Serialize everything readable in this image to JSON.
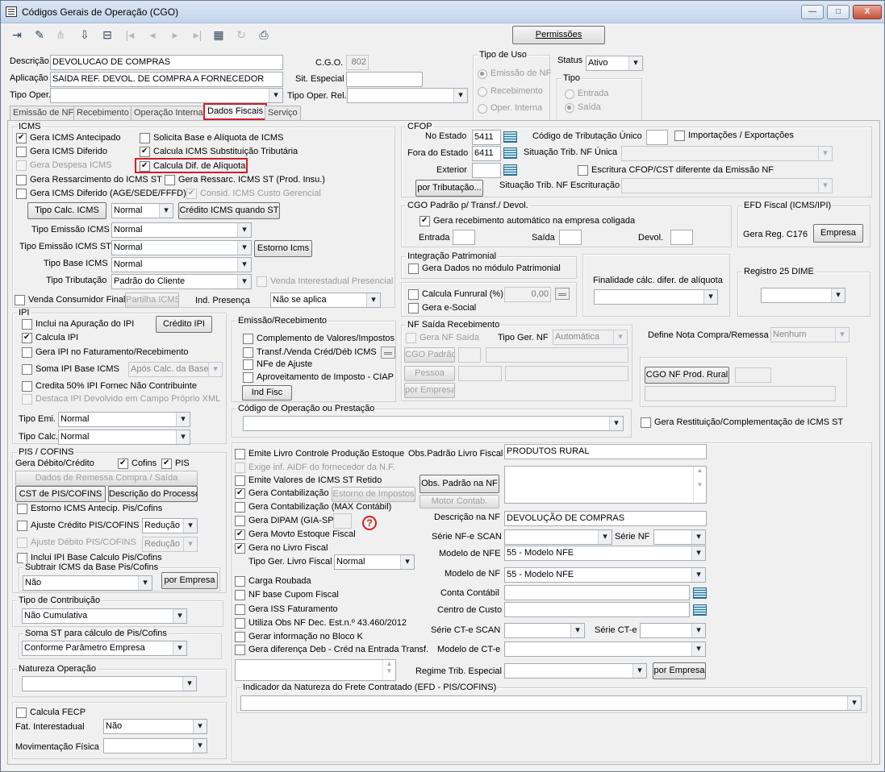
{
  "window": {
    "title": "Códigos Gerais de Operação (CGO)",
    "min": "—",
    "max": "□",
    "close": "X"
  },
  "toolbar": {
    "permissoes": "Permissões"
  },
  "header": {
    "descricao_label": "Descrição",
    "descricao_value": "DEVOLUCAO DE COMPRAS",
    "cgo_label": "C.G.O.",
    "cgo_value": "802",
    "aplicacao_label": "Aplicação",
    "aplicacao_value": "SAIDA REF. DEVOL. DE COMPRA A FORNECEDOR",
    "sit_especial_label": "Sit. Especial",
    "sit_especial_value": "",
    "tipo_oper_label": "Tipo Oper.",
    "tipo_oper_value": "",
    "tipo_oper_rel_label": "Tipo Oper. Rel.",
    "tipo_oper_rel_value": "",
    "tipo_uso_caption": "Tipo de Uso",
    "tipo_uso_options": [
      "Emissão de NF",
      "Recebimento",
      "Oper. Interna"
    ],
    "status_label": "Status",
    "status_value": "Ativo",
    "tipo_caption": "Tipo",
    "tipo_options": [
      "Entrada",
      "Saída"
    ]
  },
  "tabs": [
    "Emissão de NF",
    "Recebimento",
    "Operação Interna",
    "Dados Fiscais",
    "Serviço"
  ],
  "icms": {
    "caption": "ICMS",
    "gera_antecipado": "Gera ICMS Antecipado",
    "solicita_base": "Solicita Base e Alíquota de ICMS",
    "gera_diferido": "Gera ICMS Diferido",
    "calcula_st": "Calcula ICMS Substituição Tributária",
    "gera_despesa": "Gera Despesa ICMS",
    "calcula_dif": "Calcula Dif. de Alíquota",
    "gera_ressarcimento": "Gera Ressarcimento do ICMS ST",
    "gera_ressarc_prod": "Gera Ressarc. ICMS ST (Prod. Insu.)",
    "gera_diferido_age": "Gera ICMS Diferido (AGE/SEDE/FFFD)",
    "consid_custo": "Consid. ICMS Custo Gerencial",
    "tipo_calc_btn": "Tipo Calc. ICMS",
    "tipo_calc_value": "Normal",
    "credito_st_btn": "Crédito ICMS quando ST",
    "tipo_emissao_label": "Tipo Emissão ICMS",
    "tipo_emissao_value": "Normal",
    "tipo_emissao_st_label": "Tipo Emissão ICMS ST",
    "tipo_emissao_st_value": "Normal",
    "estorno_btn": "Estorno Icms",
    "tipo_base_label": "Tipo Base ICMS",
    "tipo_base_value": "Normal",
    "tipo_tributacao_label": "Tipo Tributação",
    "tipo_tributacao_value": "Padrão do Cliente",
    "venda_interestadual": "Venda Interestadual Presencial",
    "venda_consumidor": "Venda Consumidor Final",
    "partilha_btn": "Partilha ICMS",
    "ind_presenca_label": "Ind. Presença",
    "ind_presenca_value": "Não se aplica"
  },
  "cfop": {
    "caption": "CFOP",
    "no_estado_label": "No Estado",
    "no_estado_value": "5411",
    "fora_estado_label": "Fora do Estado",
    "fora_estado_value": "6411",
    "exterior_label": "Exterior",
    "exterior_value": "",
    "cod_trib_label": "Código de Tributação Único",
    "cod_trib_value": "",
    "importacoes": "Importações / Exportações",
    "sit_trib_label": "Situação Trib. NF Única",
    "sit_trib_value": "",
    "escritura_cfop": "Escritura CFOP/CST diferente da Emissão NF",
    "por_tributacao_btn": "por Tributação...",
    "sit_trib_escr_label": "Situação Trib. NF Escrituração",
    "sit_trib_escr_value": ""
  },
  "cgo_padrao": {
    "caption": "CGO Padrão p/ Transf./ Devol.",
    "gera_receb": "Gera recebimento automático na empresa coligada",
    "entrada_label": "Entrada",
    "saida_label": "Saída",
    "devol_label": "Devol.",
    "entrada_value": "",
    "saida_value": "",
    "devol_value": ""
  },
  "efd": {
    "caption": "EFD Fiscal (ICMS/IPI)",
    "gera_reg": "Gera Reg. C176",
    "empresa_btn": "Empresa"
  },
  "patrimonial": {
    "caption": "Integração Patrimonial",
    "gera_dados": "Gera Dados no módulo Patrimonial"
  },
  "finalidade": {
    "label": "Finalidade cálc. difer. de alíquota",
    "value": ""
  },
  "dime": {
    "caption": "Registro 25 DIME",
    "value": ""
  },
  "funrural": {
    "calcula": "Calcula Funrural (%)",
    "valor": "0,00",
    "gera_esocial": "Gera e-Social"
  },
  "ipi": {
    "caption": "IPI",
    "inclui_apuracao": "Inclui na Apuração do IPI",
    "credito_btn": "Crédito IPI",
    "calcula": "Calcula IPI",
    "gera_faturamento": "Gera IPI no Faturamento/Recebimento",
    "soma_base": "Soma IPI Base ICMS",
    "apos_calc": "Após Calc. da Base",
    "credita_50": "Credita 50% IPI Fornec Não Contribuinte",
    "destaca": "Destaca IPI Devolvido em Campo Próprio XML",
    "tipo_emi_label": "Tipo Emi.",
    "tipo_emi_value": "Normal",
    "tipo_calc_label": "Tipo Calc.",
    "tipo_calc_value": "Normal"
  },
  "emissao_receb": {
    "caption": "Emissão/Recebimento",
    "complemento": "Complemento de Valores/Impostos",
    "transf_venda": "Transf./Venda Créd/Déb ICMS",
    "nfe_ajuste": "NFe de Ajuste",
    "aproveitamento": "Aproveitamento de Imposto - CIAP",
    "ind_fisc_btn": "Ind Fisc"
  },
  "nf_saida": {
    "caption": "NF Saída Recebimento",
    "gera_nf_saida": "Gera NF Saída",
    "tipo_ger_label": "Tipo Ger. NF",
    "tipo_ger_value": "Automática",
    "cgo_padrao_btn": "CGO Padrão",
    "pessoa_btn": "Pessoa",
    "por_empresa_btn": "por Empresa"
  },
  "define_nota": {
    "label": "Define Nota Compra/Remessa",
    "value": "Nenhum"
  },
  "cgo_nf_prod": {
    "btn": "CGO NF Prod. Rural"
  },
  "cod_oper_prest": {
    "caption": "Código de Operação ou Prestação",
    "value": ""
  },
  "gera_restituicao": "Gera Restituição/Complementação de ICMS ST",
  "pis": {
    "caption": "PIS / COFINS",
    "gera_deb_cred": "Gera Débito/Crédito",
    "cofins": "Cofins",
    "pis": "PIS",
    "dados_remessa_btn": "Dados de Remessa Compra / Saída",
    "cst_btn": "CST de PIS/COFINS",
    "descricao_processo_btn": "Descrição do Processo",
    "estorno_antecip": "Estorno ICMS Antecip. Pis/Cofins",
    "ajuste_credito": "Ajuste Crédito PIS/COFINS",
    "ajuste_credito_value": "Redução",
    "ajuste_debito": "Ajuste Débito PIS/COFINS",
    "ajuste_debito_value": "Redução",
    "inclui_ipi": "Inclui IPI Base Calculo Pis/Cofins",
    "subtrair_caption": "Subtrair ICMS da Base Pis/Cofins",
    "subtrair_value": "Não",
    "por_empresa_btn": "por Empresa"
  },
  "tipo_contrib": {
    "caption": "Tipo de Contribuição",
    "value": "Não Cumulativa"
  },
  "soma_st": {
    "caption": "Soma ST para cálculo de Pis/Cofins",
    "value": "Conforme Parâmetro Empresa"
  },
  "natureza": {
    "caption": "Natureza Operação",
    "value": ""
  },
  "fecp": {
    "calcula": "Calcula FECP",
    "fat_inter_label": "Fat. Interestadual",
    "fat_inter_value": "Não",
    "mov_fisica_label": "Movimentação Física",
    "mov_fisica_value": ""
  },
  "livro": {
    "emite_livro": "Emite Livro Controle Produção Estoque",
    "exige_aidf": "Exige inf. AIDF do fornecedor da N.F.",
    "emite_valores_st": "Emite Valores de ICMS ST Retido",
    "gera_contab": "Gera Contabilização",
    "estorno_impostos_btn": "Estorno de Impostos",
    "gera_contab_max": "Gera Contabilização (MAX Contábil)",
    "gera_dipam": "Gera DIPAM (GIA-SP)",
    "help_icon": "?",
    "gera_movto": "Gera Movto Estoque Fiscal",
    "gera_livro": "Gera no Livro Fiscal",
    "tipo_ger_livro_label": "Tipo Ger. Livro Fiscal",
    "tipo_ger_livro_value": "Normal",
    "carga_roubada": "Carga Roubada",
    "nf_base_cupom": "NF base Cupom Fiscal",
    "gera_iss": "Gera ISS Faturamento",
    "utiliza_obs": "Utiliza Obs NF Dec. Est.n.º 43.460/2012",
    "gerar_bloco_k": "Gerar informação no Bloco K",
    "gera_dif_deb": "Gera diferença Deb - Créd na Entrada Transf."
  },
  "obs": {
    "padrao_livro_label": "Obs.Padrão Livro Fiscal",
    "padrao_livro_value": "PRODUTOS RURAL",
    "obs_padrao_btn": "Obs. Padrão na NF",
    "motor_btn": "Motor Contab.",
    "descricao_nf_label": "Descrição na NF",
    "descricao_nf_value": "DEVOLUÇÃO DE COMPRAS",
    "serie_nfe_scan_label": "Série NF-e SCAN",
    "serie_nfe_scan_value": "",
    "serie_nf_label": "Série NF",
    "serie_nf_value": "",
    "modelo_nfe_label": "Modelo de NFE",
    "modelo_nfe_value": "55 - Modelo NFE",
    "modelo_nf_label": "Modelo de NF",
    "modelo_nf_value": "55 - Modelo NFE",
    "conta_contabil_label": "Conta Contábil",
    "conta_contabil_value": "",
    "centro_custo_label": "Centro de Custo",
    "centro_custo_value": "",
    "serie_cte_scan_label": "Série CT-e SCAN",
    "serie_cte_scan_value": "",
    "serie_cte_label": "Série CT-e",
    "serie_cte_value": "",
    "modelo_cte_label": "Modelo de CT-e",
    "modelo_cte_value": "",
    "regime_label": "Regime Trib. Especial",
    "regime_value": "",
    "por_empresa_btn": "por Empresa"
  },
  "indicador_frete": {
    "caption": "Indicador da Natureza do Frete Contratado (EFD - PIS/COFINS)",
    "value": ""
  }
}
